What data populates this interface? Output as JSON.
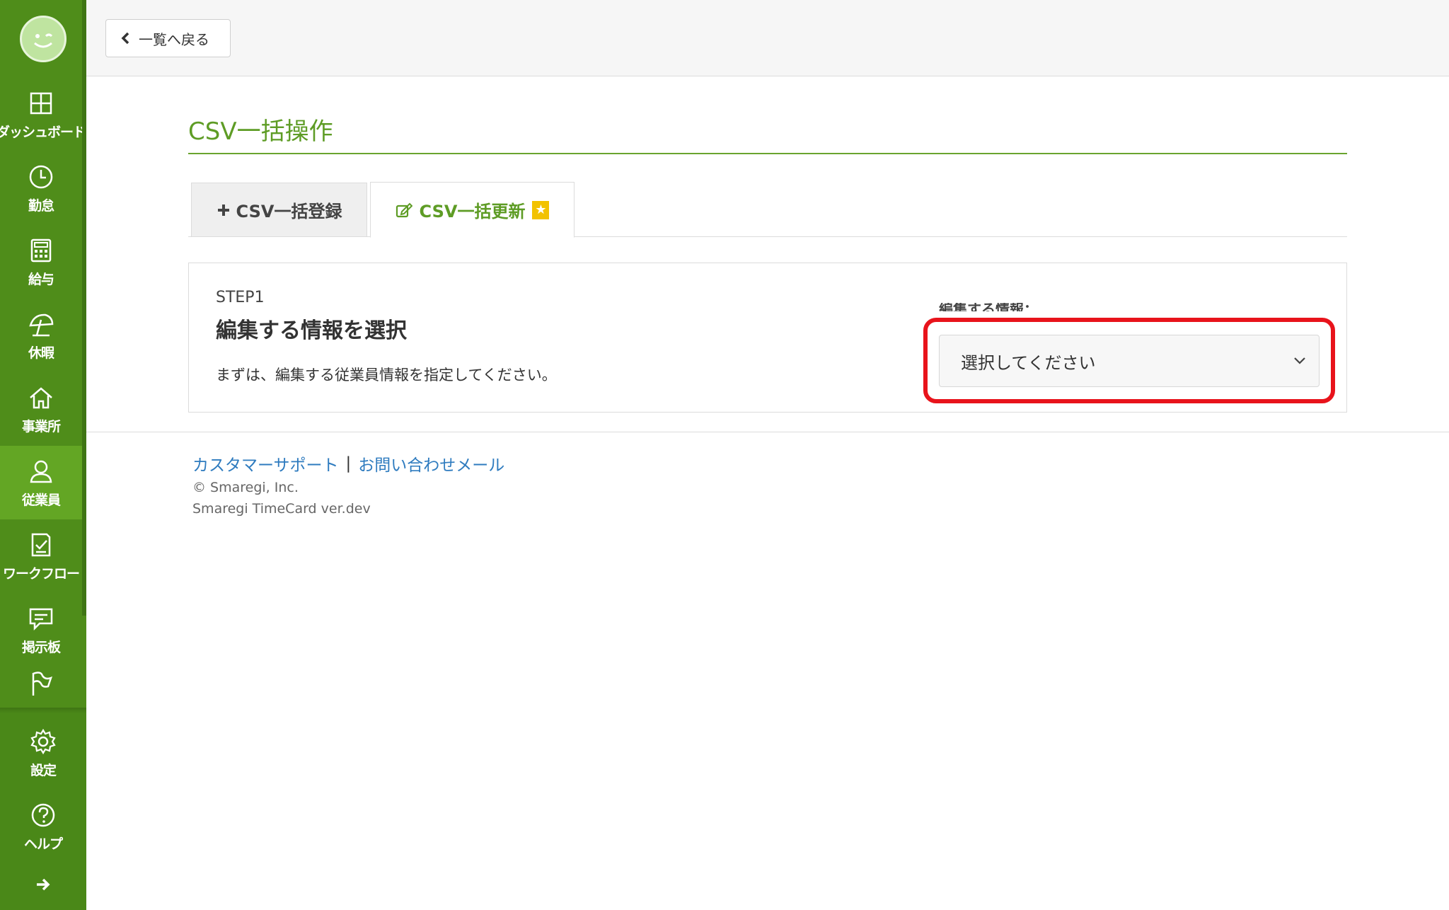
{
  "colors": {
    "sidebar_green": "#4f8d1a",
    "active_green": "#63a624",
    "title_green": "#5e9c25",
    "link_blue": "#2e7bbf",
    "highlight_red": "#e8131b",
    "badge_yellow": "#f2c200"
  },
  "sidebar": {
    "items": [
      {
        "label": "ダッシュボード",
        "icon": "dashboard-icon"
      },
      {
        "label": "勤怠",
        "icon": "clock-icon"
      },
      {
        "label": "給与",
        "icon": "calculator-icon"
      },
      {
        "label": "休暇",
        "icon": "parasol-icon"
      },
      {
        "label": "事業所",
        "icon": "home-icon"
      },
      {
        "label": "従業員",
        "icon": "user-icon",
        "active": true
      },
      {
        "label": "ワークフロー",
        "icon": "checklist-icon"
      },
      {
        "label": "掲示板",
        "icon": "chat-icon"
      },
      {
        "label": "",
        "icon": "flag-icon"
      }
    ],
    "bottom_items": [
      {
        "label": "設定",
        "icon": "gear-icon"
      },
      {
        "label": "ヘルプ",
        "icon": "help-icon"
      }
    ],
    "expand_icon": "arrow-right-icon"
  },
  "topbar": {
    "back_label": "一覧へ戻る"
  },
  "page": {
    "title": "CSV一括操作"
  },
  "tabs": [
    {
      "label": "CSV一括登録",
      "icon": "plus-icon",
      "active": false
    },
    {
      "label": "CSV一括更新",
      "icon": "edit-icon",
      "active": true,
      "badge_icon": "star-icon"
    }
  ],
  "step": {
    "label": "STEP1",
    "title": "編集する情報を選択",
    "description": "まずは、編集する従業員情報を指定してください。",
    "field_label": "編集する情報：",
    "select_value": "選択してください"
  },
  "footer": {
    "support_link": "カスタマーサポート",
    "separator": "|",
    "contact_link": "お問い合わせメール",
    "copyright": "© Smaregi, Inc.",
    "version": "Smaregi TimeCard ver.dev"
  }
}
